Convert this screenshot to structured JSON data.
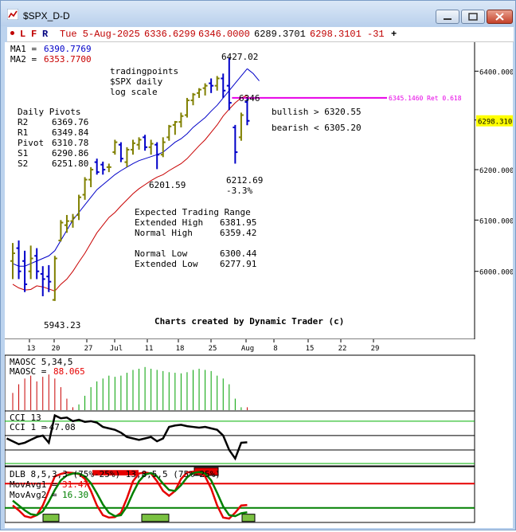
{
  "window": {
    "title": "$SPX_D-D",
    "controls": [
      "minimize-icon",
      "maximize-icon",
      "close-icon"
    ]
  },
  "infobar": {
    "mode_letters": [
      "L",
      "F",
      "R"
    ],
    "date": "Tue 5-Aug-2025",
    "open": "6336.6299",
    "high": "6346.0000",
    "low": "6289.3701",
    "close": "6298.3101",
    "change": "-31",
    "plus": "+"
  },
  "colors": {
    "up_bar": "#808000",
    "down_bar": "#0000c8",
    "ma1": "#0000c8",
    "ma2": "#c80000",
    "retracement": "#e600e6",
    "macd_pos": "#00a000",
    "macd_neg": "#c80000",
    "dlb_line1": "#e60000",
    "dlb_line2": "#008000"
  },
  "price_panel": {
    "ma1_label": "MA1 =",
    "ma1_value": "6390.7769",
    "ma2_label": "MA2 =",
    "ma2_value": "6353.7700",
    "annotation_lines": [
      "tradingpoints",
      "$SPX daily",
      "log scale"
    ],
    "pivots_title": "Daily Pivots",
    "pivots": [
      {
        "label": "R2",
        "value": "6369.76"
      },
      {
        "label": "R1",
        "value": "6349.84"
      },
      {
        "label": "Pivot",
        "value": "6310.78"
      },
      {
        "label": "S1",
        "value": "6290.86"
      },
      {
        "label": "S2",
        "value": "6251.80"
      }
    ],
    "price_labels": [
      {
        "text": "6427.02"
      },
      {
        "text": "6346"
      },
      {
        "text": "6201.59"
      },
      {
        "text": "6212.69"
      },
      {
        "text": "-3.3%"
      },
      {
        "text": "5943.23"
      }
    ],
    "retracement_label": "6345.1460 Ret 0.618",
    "bullish_text": "bullish > 6320.55",
    "bearish_text": "bearish < 6305.20",
    "range_title": "Expected Trading Range",
    "range_rows": [
      {
        "label": "Extended High",
        "value": "6381.95"
      },
      {
        "label": "Normal High",
        "value": "6359.42"
      },
      {
        "label": "Normal Low",
        "value": "6300.44"
      },
      {
        "label": "Extended Low",
        "value": "6277.91"
      }
    ],
    "credit": "Charts created by Dynamic Trader (c)",
    "current_price_tag": "6298.3101"
  },
  "x_axis": {
    "labels": [
      "13",
      "20",
      "27",
      "Jul",
      "11",
      "18",
      "25",
      "Aug",
      "8",
      "15",
      "22",
      "29"
    ]
  },
  "chart_data": [
    {
      "type": "ohlc",
      "title": "tradingpoints $SPX daily log scale",
      "scale": "log",
      "ylim": [
        5870,
        6460
      ],
      "y_ticks": [
        "6400.0000",
        "6300.0000",
        "6200.0000",
        "6100.0000",
        "6000.0000"
      ],
      "y_tick_values": [
        6400,
        6300,
        6200,
        6100,
        6000
      ],
      "bars": [
        {
          "o": 6020,
          "h": 6055,
          "l": 5985,
          "c": 6035
        },
        {
          "o": 6045,
          "h": 6060,
          "l": 5985,
          "c": 6000
        },
        {
          "o": 6020,
          "h": 6040,
          "l": 5960,
          "c": 5975
        },
        {
          "o": 6000,
          "h": 6050,
          "l": 5985,
          "c": 6025
        },
        {
          "o": 6030,
          "h": 6045,
          "l": 5985,
          "c": 6000
        },
        {
          "o": 5995,
          "h": 6010,
          "l": 5952,
          "c": 5985
        },
        {
          "o": 5990,
          "h": 6012,
          "l": 5960,
          "c": 5980
        },
        {
          "o": 5945,
          "h": 6030,
          "l": 5943,
          "c": 6025
        },
        {
          "o": 6060,
          "h": 6100,
          "l": 6058,
          "c": 6095
        },
        {
          "o": 6090,
          "h": 6110,
          "l": 6075,
          "c": 6098
        },
        {
          "o": 6098,
          "h": 6112,
          "l": 6085,
          "c": 6105
        },
        {
          "o": 6110,
          "h": 6150,
          "l": 6100,
          "c": 6145
        },
        {
          "o": 6150,
          "h": 6185,
          "l": 6140,
          "c": 6180
        },
        {
          "o": 6180,
          "h": 6205,
          "l": 6165,
          "c": 6200
        },
        {
          "o": 6215,
          "h": 6222,
          "l": 6190,
          "c": 6195
        },
        {
          "o": 6210,
          "h": 6216,
          "l": 6190,
          "c": 6200
        },
        {
          "o": 6205,
          "h": 6212,
          "l": 6195,
          "c": 6205
        },
        {
          "o": 6235,
          "h": 6260,
          "l": 6230,
          "c": 6255
        },
        {
          "o": 6250,
          "h": 6255,
          "l": 6215,
          "c": 6222
        },
        {
          "o": 6215,
          "h": 6245,
          "l": 6205,
          "c": 6240
        },
        {
          "o": 6240,
          "h": 6260,
          "l": 6230,
          "c": 6253
        },
        {
          "o": 6250,
          "h": 6265,
          "l": 6240,
          "c": 6260
        },
        {
          "o": 6265,
          "h": 6270,
          "l": 6238,
          "c": 6245
        },
        {
          "o": 6245,
          "h": 6260,
          "l": 6230,
          "c": 6252
        },
        {
          "o": 6250,
          "h": 6255,
          "l": 6201,
          "c": 6230
        },
        {
          "o": 6230,
          "h": 6265,
          "l": 6225,
          "c": 6255
        },
        {
          "o": 6265,
          "h": 6290,
          "l": 6258,
          "c": 6287
        },
        {
          "o": 6290,
          "h": 6298,
          "l": 6270,
          "c": 6296
        },
        {
          "o": 6296,
          "h": 6315,
          "l": 6285,
          "c": 6308
        },
        {
          "o": 6310,
          "h": 6345,
          "l": 6305,
          "c": 6340
        },
        {
          "o": 6340,
          "h": 6355,
          "l": 6330,
          "c": 6352
        },
        {
          "o": 6355,
          "h": 6365,
          "l": 6345,
          "c": 6362
        },
        {
          "o": 6365,
          "h": 6375,
          "l": 6350,
          "c": 6370
        },
        {
          "o": 6375,
          "h": 6385,
          "l": 6355,
          "c": 6370
        },
        {
          "o": 6370,
          "h": 6390,
          "l": 6360,
          "c": 6385
        },
        {
          "o": 6385,
          "h": 6395,
          "l": 6345,
          "c": 6360
        },
        {
          "o": 6370,
          "h": 6427,
          "l": 6320,
          "c": 6335
        },
        {
          "o": 6285,
          "h": 6290,
          "l": 6212,
          "c": 6235
        },
        {
          "o": 6265,
          "h": 6315,
          "l": 6258,
          "c": 6310
        },
        {
          "o": 6336.63,
          "h": 6346.0,
          "l": 6289.37,
          "c": 6298.31
        }
      ],
      "ma1": [
        6015,
        6010,
        6010,
        6015,
        6020,
        6025,
        6030,
        6040,
        6060,
        6080,
        6100,
        6115,
        6130,
        6145,
        6160,
        6170,
        6180,
        6190,
        6198,
        6205,
        6212,
        6218,
        6222,
        6226,
        6230,
        6235,
        6245,
        6255,
        6262,
        6272,
        6285,
        6295,
        6305,
        6318,
        6330,
        6345,
        6360,
        6375,
        6390,
        6405
      ],
      "ma1_projection": [
        6395,
        6380
      ],
      "ma2": [
        5975,
        5968,
        5964,
        5965,
        5972,
        5970,
        5966,
        5962,
        5975,
        5985,
        6000,
        6018,
        6035,
        6055,
        6075,
        6090,
        6105,
        6115,
        6128,
        6140,
        6152,
        6162,
        6170,
        6178,
        6185,
        6190,
        6198,
        6205,
        6212,
        6222,
        6235,
        6248,
        6260,
        6275,
        6290,
        6308,
        6322,
        6335,
        6345,
        6350
      ],
      "retracement": {
        "value": 6345.146,
        "ratio": 0.618
      }
    },
    {
      "type": "bar",
      "title": "MAOSC 5,34,5",
      "legend": "MAOSC =",
      "legend_value": "88.065",
      "values": [
        -30,
        -45,
        -55,
        -60,
        -50,
        -58,
        -62,
        -55,
        -40,
        -20,
        -5,
        10,
        25,
        40,
        50,
        55,
        60,
        58,
        60,
        65,
        70,
        72,
        75,
        72,
        70,
        68,
        66,
        65,
        64,
        66,
        70,
        72,
        70,
        68,
        60,
        55,
        45,
        20,
        5,
        -5
      ],
      "ylim": [
        -80,
        90
      ]
    },
    {
      "type": "line",
      "title": "CCI 13",
      "legend": "CCI 1 =",
      "legend_value": "-47.08",
      "values": [
        -20,
        -40,
        -60,
        -50,
        -30,
        -10,
        0,
        -50,
        140,
        120,
        125,
        100,
        110,
        95,
        100,
        90,
        60,
        50,
        40,
        20,
        -10,
        -20,
        -30,
        -20,
        -10,
        -40,
        -20,
        60,
        70,
        75,
        65,
        60,
        55,
        60,
        50,
        40,
        0,
        -100,
        -160,
        -50,
        -47
      ],
      "ref_lines": [
        100,
        0,
        -100
      ],
      "ylim": [
        -200,
        160
      ]
    },
    {
      "type": "line",
      "title": "DLB 8,5,3,3 (75%-25%) 13,8,5,5 (75%-25%)",
      "series": [
        {
          "name": "MovAvg1 =",
          "value": "31.47",
          "values": [
            30,
            20,
            8,
            5,
            10,
            30,
            60,
            90,
            95,
            98,
            97,
            95,
            85,
            60,
            30,
            10,
            5,
            6,
            15,
            45,
            80,
            96,
            98,
            96,
            80,
            60,
            50,
            60,
            85,
            98,
            100,
            98,
            90,
            65,
            30,
            5,
            3,
            15,
            30,
            31
          ]
        },
        {
          "name": "MovAvg2 =",
          "value": "16.30",
          "values": [
            40,
            30,
            20,
            12,
            10,
            18,
            38,
            62,
            82,
            92,
            96,
            96,
            90,
            76,
            55,
            32,
            15,
            8,
            10,
            28,
            56,
            80,
            94,
            97,
            90,
            75,
            62,
            60,
            72,
            88,
            97,
            99,
            96,
            82,
            56,
            28,
            10,
            8,
            14,
            16
          ]
        }
      ],
      "ref_lines": [
        75,
        25
      ],
      "ylim": [
        -5,
        110
      ]
    }
  ]
}
